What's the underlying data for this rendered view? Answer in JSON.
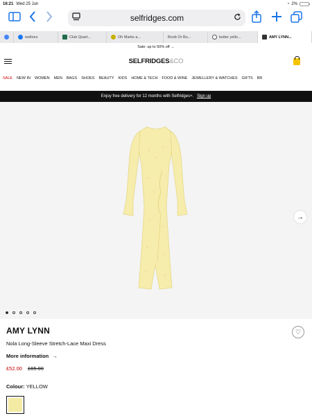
{
  "status": {
    "time": "16:21",
    "date": "Wed 25 Jun",
    "battery": "2%"
  },
  "browser": {
    "url": "selfridges.com",
    "tabs": [
      {
        "label": "wellnes",
        "fav_color": "#1877f2"
      },
      {
        "label": "Club Quart...",
        "fav_color": "#1f6b4a"
      },
      {
        "label": "Oh Marks a...",
        "fav_color": "#c6b000"
      },
      {
        "label": "Boob Or Bu...",
        "fav_color": "#e2e2e2"
      },
      {
        "label": "butter yello...",
        "fav_color": "#555555"
      },
      {
        "label": "AMY LYNN...",
        "fav_color": "#333333"
      }
    ]
  },
  "promo": "Sale: up to 50% off →",
  "header": {
    "logo": "SELFRIDGES",
    "logo_amp": "&CO"
  },
  "nav": {
    "items": [
      "SALE",
      "NEW IN",
      "WOMEN",
      "MEN",
      "BAGS",
      "SHOES",
      "BEAUTY",
      "KIDS",
      "HOME & TECH",
      "FOOD & WINE",
      "JEWELLERY & WATCHES",
      "GIFTS",
      "BR"
    ]
  },
  "delivery": {
    "text": "Enjoy free delivery for 12 months with Selfridges+.",
    "link": "Sign up"
  },
  "product": {
    "brand": "AMY LYNN",
    "name": "Nola Long-Sleeve Stretch-Lace Maxi Dress",
    "more_info": "More information",
    "price": "£52.00",
    "was_price": "£65.00",
    "colour_label": "Colour:",
    "colour": "YELLOW",
    "swatch_color": "#f3eaa3",
    "dress_color": "#f6ecac",
    "image_count": 5,
    "active_image": 1
  }
}
